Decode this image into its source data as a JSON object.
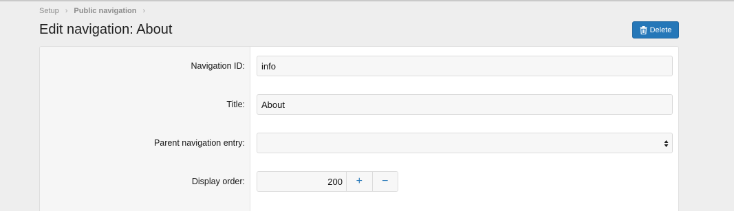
{
  "breadcrumb": {
    "items": [
      "Setup",
      "Public navigation"
    ],
    "separator": "›"
  },
  "page": {
    "title": "Edit navigation: About"
  },
  "toolbar": {
    "delete_label": "Delete",
    "delete_icon": "trash-icon"
  },
  "form": {
    "navigation_id": {
      "label": "Navigation ID:",
      "value": "info"
    },
    "title": {
      "label": "Title:",
      "value": "About"
    },
    "parent": {
      "label": "Parent navigation entry:",
      "value": ""
    },
    "display_order": {
      "label": "Display order:",
      "value": "200",
      "increment": "+",
      "decrement": "−"
    }
  },
  "colors": {
    "accent": "#2577b8",
    "background": "#eeeeee",
    "panel": "#ffffff",
    "label_column": "#f6f6f6"
  }
}
